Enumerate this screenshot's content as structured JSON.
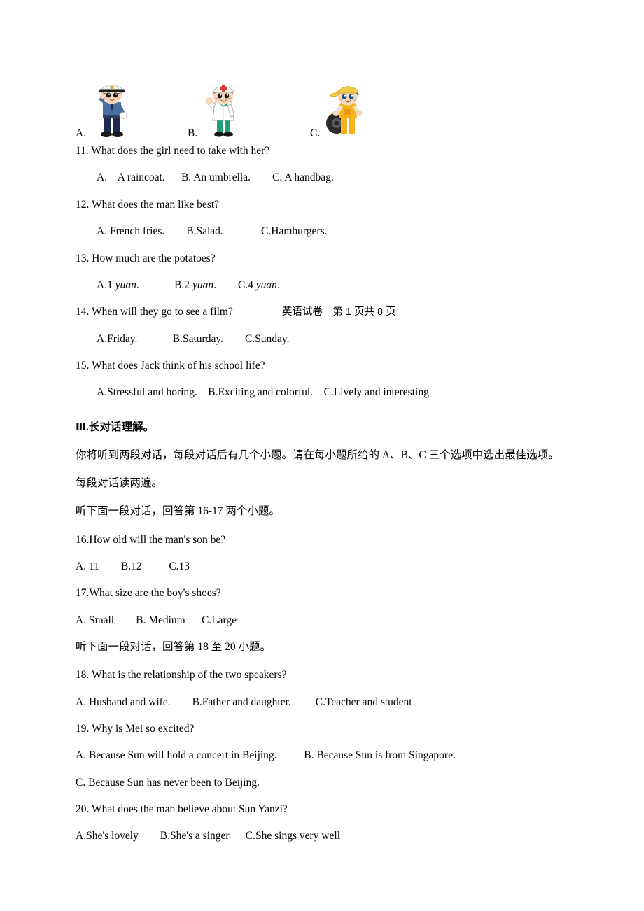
{
  "document": {
    "page_marker": "英语试卷　第 1 页共 8 页",
    "picture_options": {
      "label_a": "A.",
      "label_b": "B.",
      "label_c": "C.",
      "figure_a": "policeman-saluting-illustration",
      "figure_b": "doctor-waving-illustration",
      "figure_c": "mechanic-with-tire-illustration"
    },
    "questions_short": [
      {
        "number": "11.",
        "stem": "11. What does the girl need to take with her?",
        "options": "A.    A raincoat.      B. An umbrella.        C. A handbag."
      },
      {
        "number": "12.",
        "stem": "12. What does the man like best?",
        "options": "A. French fries.        B.Salad.              C.Hamburgers."
      },
      {
        "number": "13.",
        "stem": "13. How much are the potatoes?",
        "options_pre_a": "A.1 ",
        "options_it_a": "yuan",
        "options_mid_a": ".             B.2 ",
        "options_it_b": "yuan",
        "options_mid_b": ".        C.4 ",
        "options_it_c": "yuan",
        "options_end": "."
      },
      {
        "number": "14.",
        "stem": "14. When will they go to see a film?",
        "options": "A.Friday.             B.Saturday.        C.Sunday."
      },
      {
        "number": "15.",
        "stem": "15. What does Jack think of his school life?",
        "options": "A.Stressful and boring.    B.Exciting and colorful.    C.Lively and interesting"
      }
    ],
    "section": {
      "heading": "Ⅲ.长对话理解。",
      "instruction_1": "你将听到两段对话，每段对话后有几个小题。请在每小题所给的 A、B、C 三个选项中选出最佳选项。",
      "instruction_2": "每段对话读两遍。",
      "instruction_3": "听下面一段对话，回答第 16-17 两个小题。",
      "instruction_4": "听下面一段对话，回答第 18 至 20 小题。"
    },
    "questions_long": [
      {
        "stem": "16.How old will the man's son be?",
        "options": "A. 11        B.12          C.13"
      },
      {
        "stem": "17.What size are the boy's shoes?",
        "options": "A. Small        B. Medium      C.Large"
      },
      {
        "stem": "18. What is the relationship of the two speakers?",
        "options": "A. Husband and wife.        B.Father and daughter.         C.Teacher and student"
      },
      {
        "stem": "19. Why is Mei so excited?",
        "options_line1": "A. Because Sun will hold a concert in Beijing.          B. Because Sun is from Singapore.",
        "options_line2": "C. Because Sun has never been to Beijing."
      },
      {
        "stem": "20. What does the man believe about Sun Yanzi?",
        "options": "A.She's lovely        B.She's a singer      C.She sings very well"
      }
    ]
  },
  "colors": {
    "page_background": "#ffffff",
    "text": "#000000",
    "police_cap": "#f0f0f2",
    "police_shirt": "#4a6f9e",
    "police_pants": "#1f2a50",
    "doctor_coat": "#ffffff",
    "doctor_pants": "#1f9e7a",
    "doctor_cross": "#d93a3a",
    "mechanic_cap": "#f7c843",
    "mechanic_overalls": "#f5b31c",
    "tire": "#2b2b2b",
    "skin": "#f6d9bc",
    "hair": "#2a2118"
  }
}
